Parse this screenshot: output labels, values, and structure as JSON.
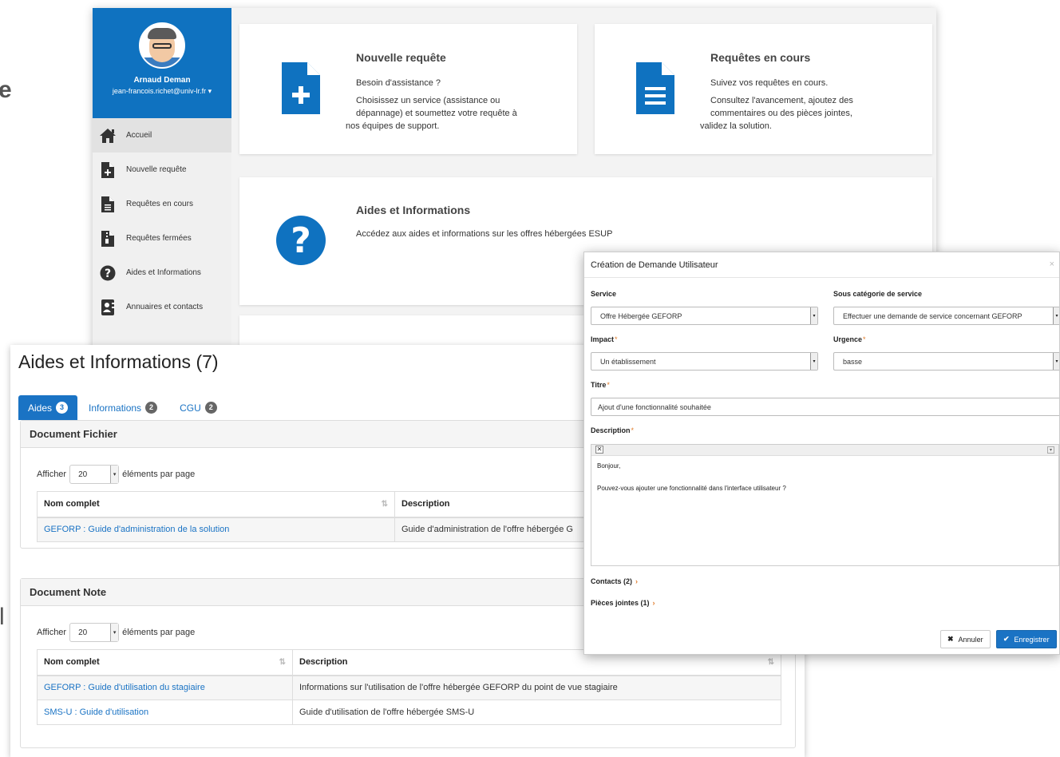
{
  "edge_glyphs": [
    "e",
    "l"
  ],
  "portal": {
    "user": {
      "name": "Arnaud Deman",
      "email": "jean-francois.richet@univ-lr.fr ▾"
    },
    "nav": [
      {
        "label": "Accueil",
        "icon": "home-icon"
      },
      {
        "label": "Nouvelle requête",
        "icon": "file-plus-icon"
      },
      {
        "label": "Requêtes en cours",
        "icon": "file-text-icon"
      },
      {
        "label": "Requêtes fermées",
        "icon": "file-archive-icon"
      },
      {
        "label": "Aides et Informations",
        "icon": "question-circle-icon"
      },
      {
        "label": "Annuaires et contacts",
        "icon": "address-book-icon"
      }
    ],
    "cards": {
      "new_request": {
        "title": "Nouvelle requête",
        "line1": "Besoin d'assistance ?",
        "line2": "Choisissez un service (assistance ou",
        "line3": "dépannage) et soumettez votre requête à",
        "line4": "nos équipes de support."
      },
      "current_requests": {
        "title": "Requêtes en cours",
        "line1": "Suivez vos requêtes en cours.",
        "line2": "Consultez l'avancement, ajoutez des",
        "line3": "commentaires ou des pièces jointes,",
        "line4": "validez la solution."
      },
      "help": {
        "title": "Aides et Informations",
        "line1": "Accédez aux aides et informations sur les offres hébergées ESUP"
      }
    },
    "colors": {
      "brand_blue": "#0f72c0"
    }
  },
  "aides": {
    "title": "Aides et Informations (7)",
    "tabs": [
      {
        "label": "Aides",
        "count": "3"
      },
      {
        "label": "Informations",
        "count": "2"
      },
      {
        "label": "CGU",
        "count": "2"
      }
    ],
    "pager": {
      "before": "Afficher",
      "value": "20",
      "after": "éléments par page"
    },
    "panel_fichier": {
      "title": "Document Fichier",
      "columns": [
        "Nom complet",
        "Description"
      ],
      "rows": [
        {
          "name": "GEFORP : Guide d'administration de la solution",
          "description": "Guide d'administration de l'offre hébergée G"
        }
      ]
    },
    "panel_note": {
      "title": "Document Note",
      "columns": [
        "Nom complet",
        "Description"
      ],
      "rows": [
        {
          "name": "GEFORP : Guide d'utilisation du stagiaire",
          "description": "Informations sur l'utilisation de l'offre hébergée GEFORP du point de vue stagiaire"
        },
        {
          "name": "SMS-U : Guide d'utilisation",
          "description": "Guide d'utilisation de l'offre hébergée SMS-U"
        }
      ]
    }
  },
  "modal": {
    "title": "Création de Demande Utilisateur",
    "close": "×",
    "service": {
      "label": "Service",
      "value": "Offre Hébergée GEFORP"
    },
    "subcategory": {
      "label": "Sous catégorie de service",
      "value": "Effectuer une demande de service concernant GEFORP"
    },
    "impact": {
      "label": "Impact",
      "value": "Un établissement"
    },
    "urgency": {
      "label": "Urgence",
      "value": "basse"
    },
    "title_field": {
      "label": "Titre",
      "value": "Ajout d'une fonctionnalité souhaitée"
    },
    "description": {
      "label": "Description",
      "line1": "Bonjour,",
      "line2": "Pouvez-vous ajouter une fonctionnalité dans l'interface utilisateur ?"
    },
    "contacts": "Contacts (2)",
    "attachments": "Pièces jointes (1)",
    "required_mark": "*",
    "cancel_label": "Annuler",
    "save_label": "Enregistrer"
  }
}
